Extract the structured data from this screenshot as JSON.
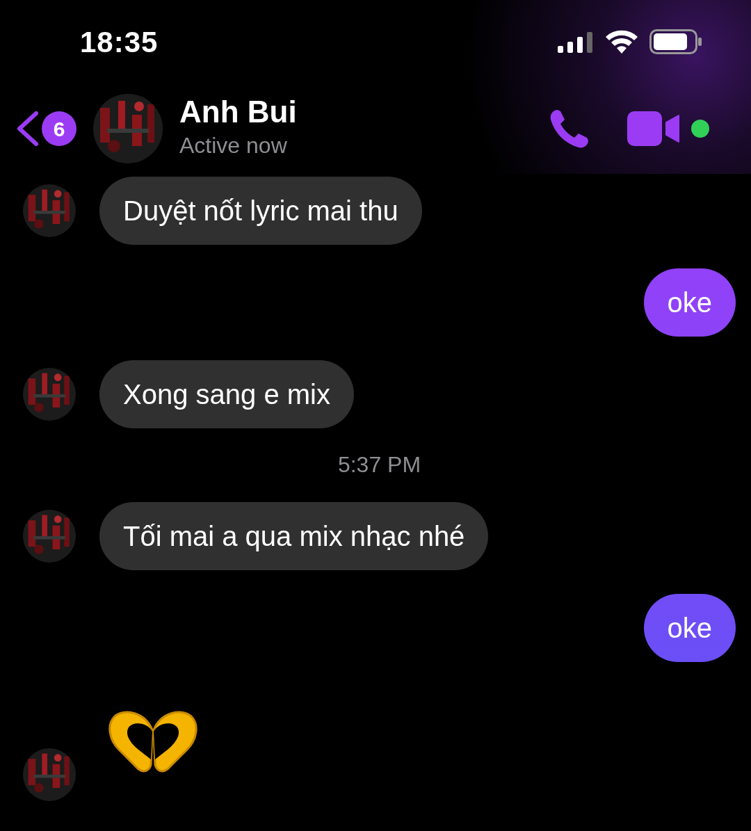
{
  "status_bar": {
    "time": "18:35"
  },
  "header": {
    "unread_count": "6",
    "name": "Anh Bui",
    "status": "Active now",
    "online": true
  },
  "messages": [
    {
      "kind": "incoming",
      "text": "Duyệt nốt lyric mai thu"
    },
    {
      "kind": "outgoing",
      "text": "oke"
    },
    {
      "kind": "incoming",
      "text": "Xong sang e mix"
    },
    {
      "kind": "timestamp",
      "text": "5:37 PM"
    },
    {
      "kind": "incoming",
      "text": "Tối mai a qua mix nhạc nhé"
    },
    {
      "kind": "outgoing",
      "text": "oke"
    },
    {
      "kind": "emoji"
    }
  ]
}
